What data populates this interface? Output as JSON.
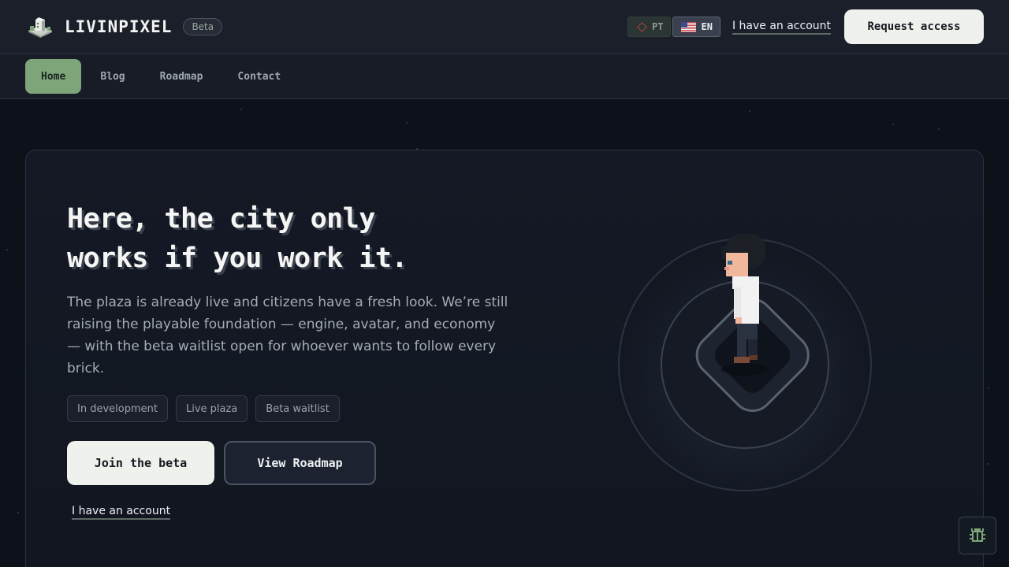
{
  "brand": {
    "name": "LIVINPIXEL",
    "badge": "Beta",
    "logo_icon": "pixel-building-logo"
  },
  "header": {
    "languages": [
      {
        "code": "PT",
        "flag": "brazil-flag-icon",
        "active": false
      },
      {
        "code": "EN",
        "flag": "us-flag-icon",
        "active": true
      }
    ],
    "account_link": "I have an account",
    "request_button": "Request access"
  },
  "nav": {
    "items": [
      {
        "label": "Home",
        "active": true
      },
      {
        "label": "Blog",
        "active": false
      },
      {
        "label": "Roadmap",
        "active": false
      },
      {
        "label": "Contact",
        "active": false
      }
    ]
  },
  "hero": {
    "headline_line1": "Here, the city only",
    "headline_line2": "works if you work it.",
    "description": "The plaza is already live and citizens have a fresh look. We’re still raising the playable foundation — engine, avatar, and economy — with the beta waitlist open for whoever wants to follow every brick.",
    "tags": [
      "In development",
      "Live plaza",
      "Beta waitlist"
    ],
    "primary_cta": "Join the beta",
    "secondary_cta": "View Roadmap",
    "account_link": "I have an account"
  },
  "floating": {
    "bug_icon": "bug-report-icon"
  },
  "colors": {
    "accent_green": "#7ea57a",
    "background": "#0d1119",
    "button_light": "#eff1ed"
  }
}
